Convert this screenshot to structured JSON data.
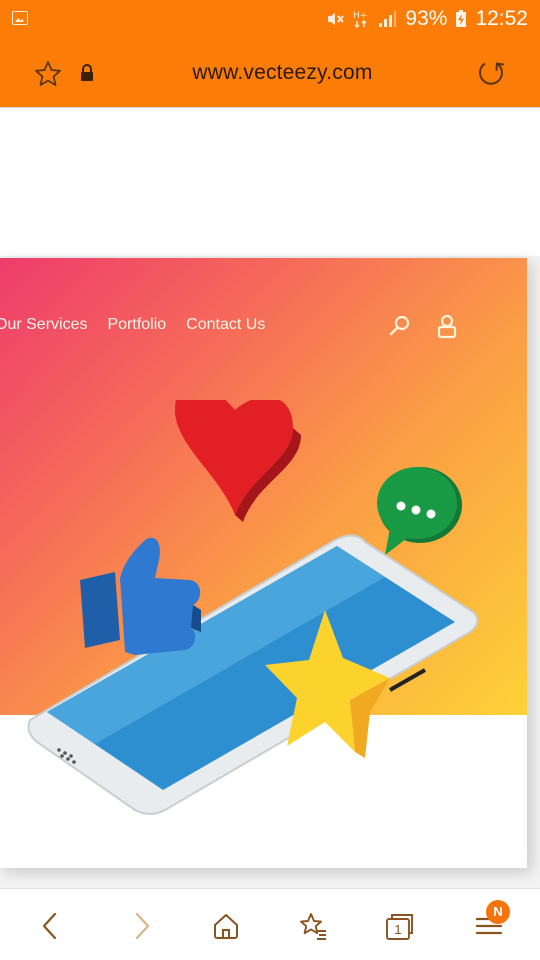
{
  "status_bar": {
    "battery": "93%",
    "time": "12:52",
    "icons": [
      "image-icon",
      "mute-icon",
      "data-h-plus-icon",
      "signal-icon",
      "battery-charging-icon"
    ]
  },
  "browser": {
    "url": "www.vecteezy.com",
    "icons": [
      "star-icon",
      "lock-icon",
      "reload-icon"
    ]
  },
  "webpage": {
    "nav": [
      "Our Services",
      "Portfolio",
      "Contact Us"
    ],
    "icons": [
      "search-icon",
      "user-icon"
    ]
  },
  "toolbar": {
    "tabs_count": "1",
    "badge": "N",
    "icons": [
      "back-icon",
      "forward-icon",
      "home-icon",
      "bookmarks-icon",
      "tabs-icon",
      "menu-icon"
    ]
  },
  "colors": {
    "brand": "#fb7d08",
    "toolbar_icon": "#8a5320",
    "badge": "#f7740c"
  }
}
